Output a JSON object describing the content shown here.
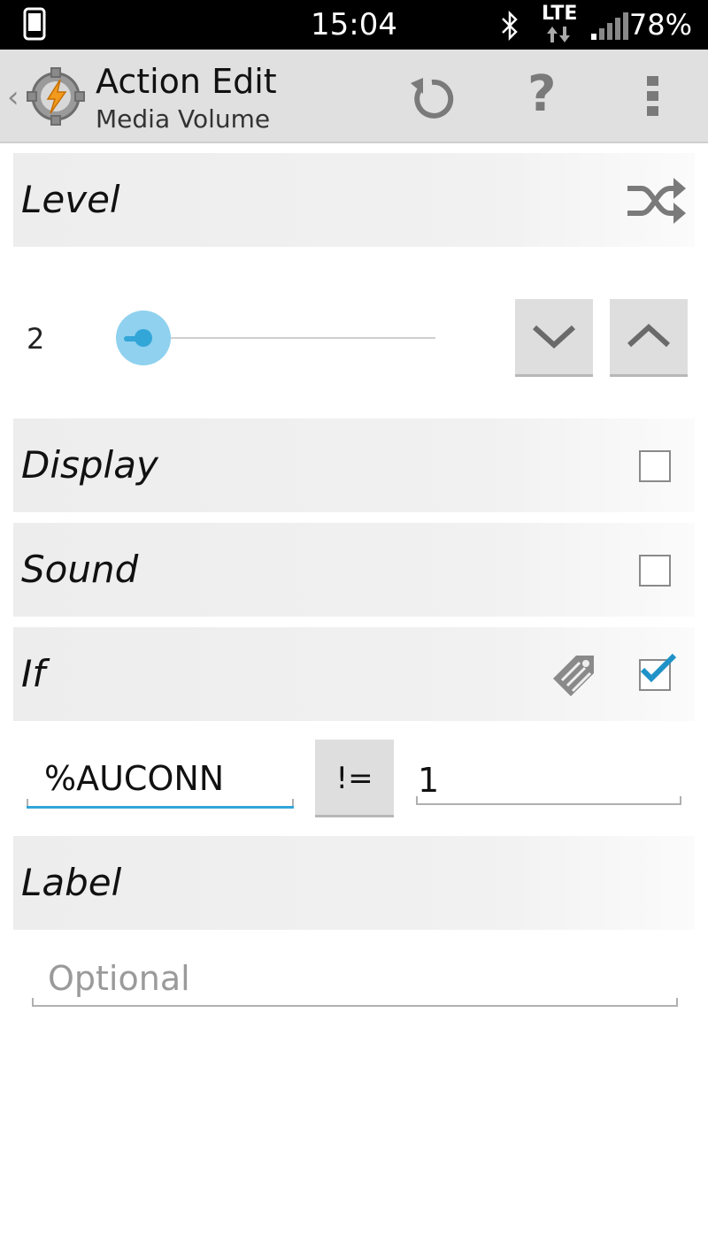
{
  "status_bar": {
    "time": "15:04",
    "network": "LTE",
    "battery": "78%",
    "icons": [
      "phone-icon",
      "bluetooth-icon",
      "data-arrows-icon",
      "signal-icon"
    ]
  },
  "action_bar": {
    "title": "Action Edit",
    "subtitle": "Media Volume",
    "help_label": "?",
    "icons": [
      "tasker-app-icon",
      "undo-icon",
      "help-icon",
      "overflow-menu-icon"
    ]
  },
  "level": {
    "label": "Level",
    "value": "2",
    "slider_fraction": 0.13,
    "icons": [
      "shuffle-icon",
      "chevron-down-icon",
      "chevron-up-icon"
    ]
  },
  "display": {
    "label": "Display",
    "checked": false
  },
  "sound": {
    "label": "Sound",
    "checked": false
  },
  "if_section": {
    "label": "If",
    "checked": true,
    "variable": "%AUCONN",
    "operator": "!=",
    "compare_value": "1",
    "icons": [
      "tag-edit-icon",
      "checkmark-icon"
    ]
  },
  "label_section": {
    "label": "Label",
    "placeholder": "Optional"
  },
  "colors": {
    "accent": "#33a6d8",
    "section_bg": "#efefef",
    "actionbar_bg": "#e0e0e0"
  }
}
